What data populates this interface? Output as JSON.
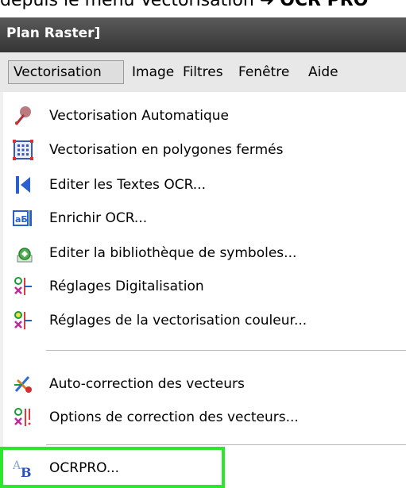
{
  "caption": {
    "text": "depuis le menu Vectorisation",
    "arrow": "➜",
    "bold": "OCR PRO"
  },
  "window": {
    "title": "Plan Raster]"
  },
  "menubar": {
    "items": [
      "Vectorisation",
      "Image",
      "Filtres",
      "Fenêtre",
      "Aide"
    ]
  },
  "dropdown": {
    "items": [
      {
        "label": "Vectorisation Automatique",
        "icon": "auto-vectorize-icon"
      },
      {
        "label": "Vectorisation en polygones fermés",
        "icon": "polygon-grid-icon"
      },
      {
        "label": "Editer les Textes OCR...",
        "icon": "text-cursor-icon"
      },
      {
        "label": "Enrichir OCR...",
        "icon": "ocr-enrich-icon"
      },
      {
        "label": "Editer la bibliothèque de symboles...",
        "icon": "symbol-library-icon"
      },
      {
        "label": "Réglages Digitalisation",
        "icon": "digitize-settings-icon"
      },
      {
        "label": "Réglages de la vectorisation couleur...",
        "icon": "color-vectorize-settings-icon"
      },
      {
        "label": "Auto-correction des vecteurs",
        "icon": "auto-correct-icon"
      },
      {
        "label": "Options de correction des vecteurs...",
        "icon": "correction-options-icon"
      },
      {
        "label": "OCRPRO...",
        "icon": "ocrpro-icon"
      }
    ]
  },
  "colors": {
    "highlight": "#2ee62e",
    "titlebar": "#3f3f3f",
    "menubar": "#e8e8e8"
  }
}
